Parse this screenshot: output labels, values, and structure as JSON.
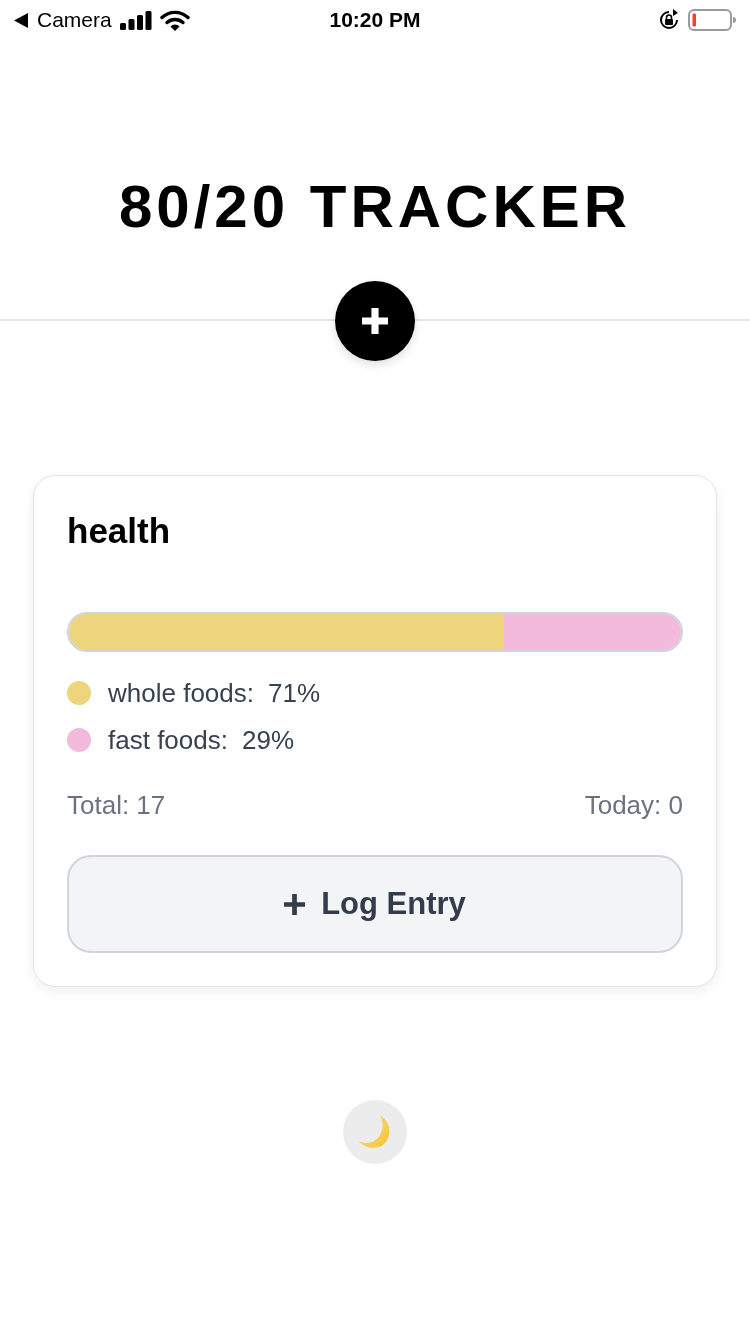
{
  "status_bar": {
    "back_label": "Camera",
    "time": "10:20 PM"
  },
  "header": {
    "title": "80/20 TRACKER"
  },
  "cards": [
    {
      "title": "health",
      "segments": [
        {
          "label": "whole foods:",
          "value": "71%",
          "level": 0.71,
          "color": "#ecd57c"
        },
        {
          "label": "fast foods:",
          "value": "29%",
          "level": 0.29,
          "color": "#f2badb"
        }
      ],
      "total": "Total: 17",
      "today": "Today: 0",
      "button": "Log Entry"
    }
  ]
}
